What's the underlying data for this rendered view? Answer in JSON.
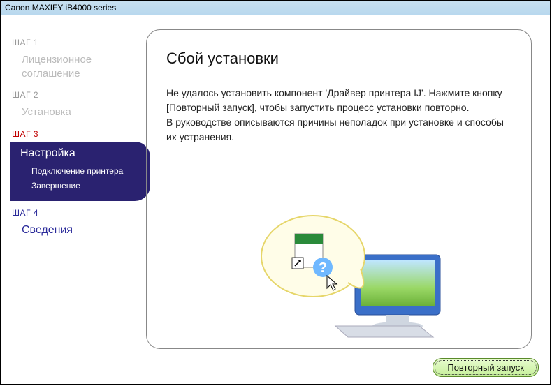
{
  "window": {
    "title": "Canon MAXIFY iB4000 series"
  },
  "sidebar": {
    "step1_label": "ШАГ 1",
    "step1_item": "Лицензионное соглашение",
    "step2_label": "ШАГ 2",
    "step2_item": "Установка",
    "step3_label": "ШАГ 3",
    "step3_main": "Настройка",
    "step3_sub1": "Подключение принтера",
    "step3_sub2": "Завершение",
    "step4_label": "ШАГ 4",
    "step4_item": "Сведения"
  },
  "content": {
    "heading": "Сбой установки",
    "para1": "Не удалось установить компонент 'Драйвер принтера IJ'. Нажмите кнопку [Повторный запуск], чтобы запустить процесс установки повторно.",
    "para2": "В руководстве описываются причины неполадок при установке и способы их устранения."
  },
  "footer": {
    "retry": "Повторный запуск"
  }
}
